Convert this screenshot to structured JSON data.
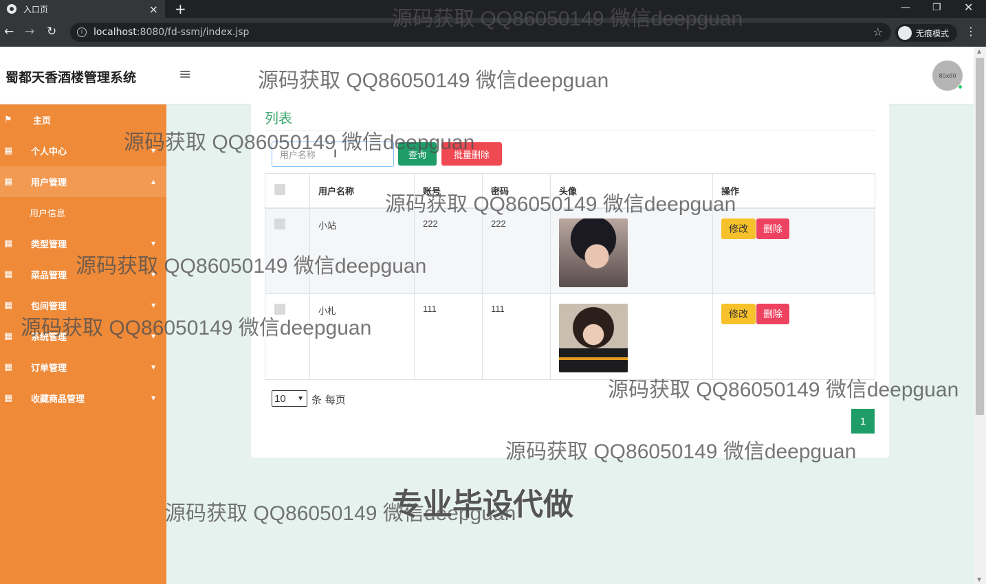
{
  "browser": {
    "tab_title": "入口页",
    "tab_close": "×",
    "new_tab": "+",
    "url_host": "localhost",
    "url_rest": ":8080/fd-ssmj/index.jsp",
    "incognito_label": "无痕模式"
  },
  "app": {
    "brand": "蜀都天香酒楼管理系统",
    "avatar_text": "80x80"
  },
  "sidebar": {
    "items": [
      {
        "label": "主页"
      },
      {
        "label": "个人中心"
      },
      {
        "label": "用户管理"
      },
      {
        "label": "用户信息"
      },
      {
        "label": "类型管理"
      },
      {
        "label": "菜品管理"
      },
      {
        "label": "包间管理"
      },
      {
        "label": "系统管理"
      },
      {
        "label": "订单管理"
      },
      {
        "label": "收藏商品管理"
      }
    ]
  },
  "card": {
    "title": "列表",
    "search_placeholder": "用户名称",
    "search_button": "查询",
    "batch_delete_button": "批量删除"
  },
  "table": {
    "headers": [
      "用户名称",
      "账号",
      "密码",
      "头像",
      "操作"
    ],
    "rows": [
      {
        "name": "小站",
        "account": "222",
        "password": "222"
      },
      {
        "name": "小札",
        "account": "111",
        "password": "111"
      }
    ],
    "edit_label": "修改",
    "delete_label": "删除"
  },
  "pagination": {
    "page_size": "10",
    "page_size_suffix": "条 每页",
    "current_page": "1"
  },
  "watermarks": {
    "text": "源码获取 QQ86050149 微信deepguan",
    "big": "专业毕设代做"
  }
}
